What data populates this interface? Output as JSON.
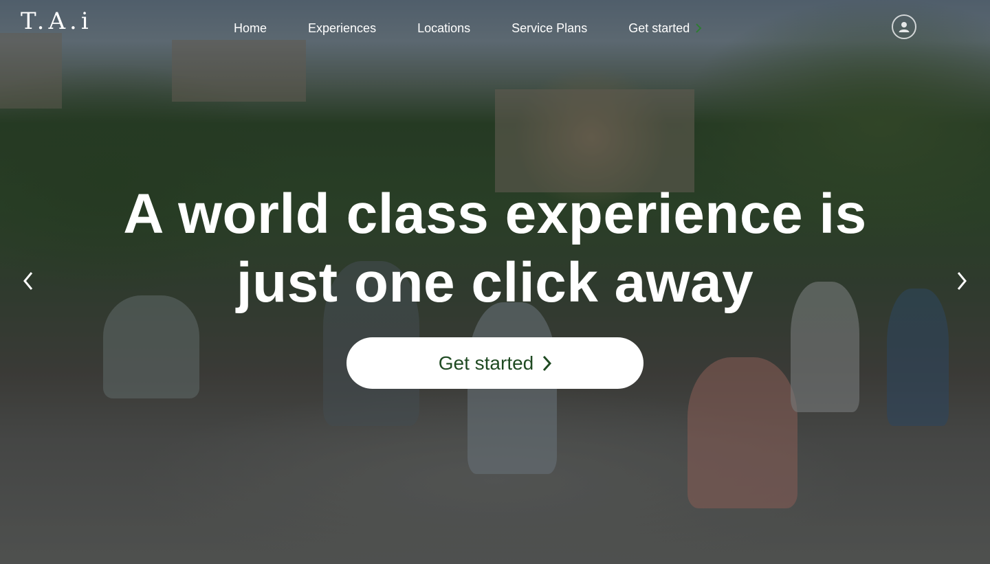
{
  "brand": {
    "logo_text": "T.A.i"
  },
  "nav": {
    "items": [
      {
        "label": "Home"
      },
      {
        "label": "Experiences"
      },
      {
        "label": "Locations"
      },
      {
        "label": "Service Plans"
      },
      {
        "label": "Get started"
      }
    ]
  },
  "hero": {
    "headline_line1": "A world class experience is",
    "headline_line2": "just one click away",
    "cta_label": "Get started"
  },
  "icons": {
    "account": "user-icon",
    "prev": "chevron-left-icon",
    "next": "chevron-right-icon"
  },
  "colors": {
    "cta_text": "#1f4a22",
    "nav_chevron": "#2e7d32",
    "text": "#ffffff"
  }
}
